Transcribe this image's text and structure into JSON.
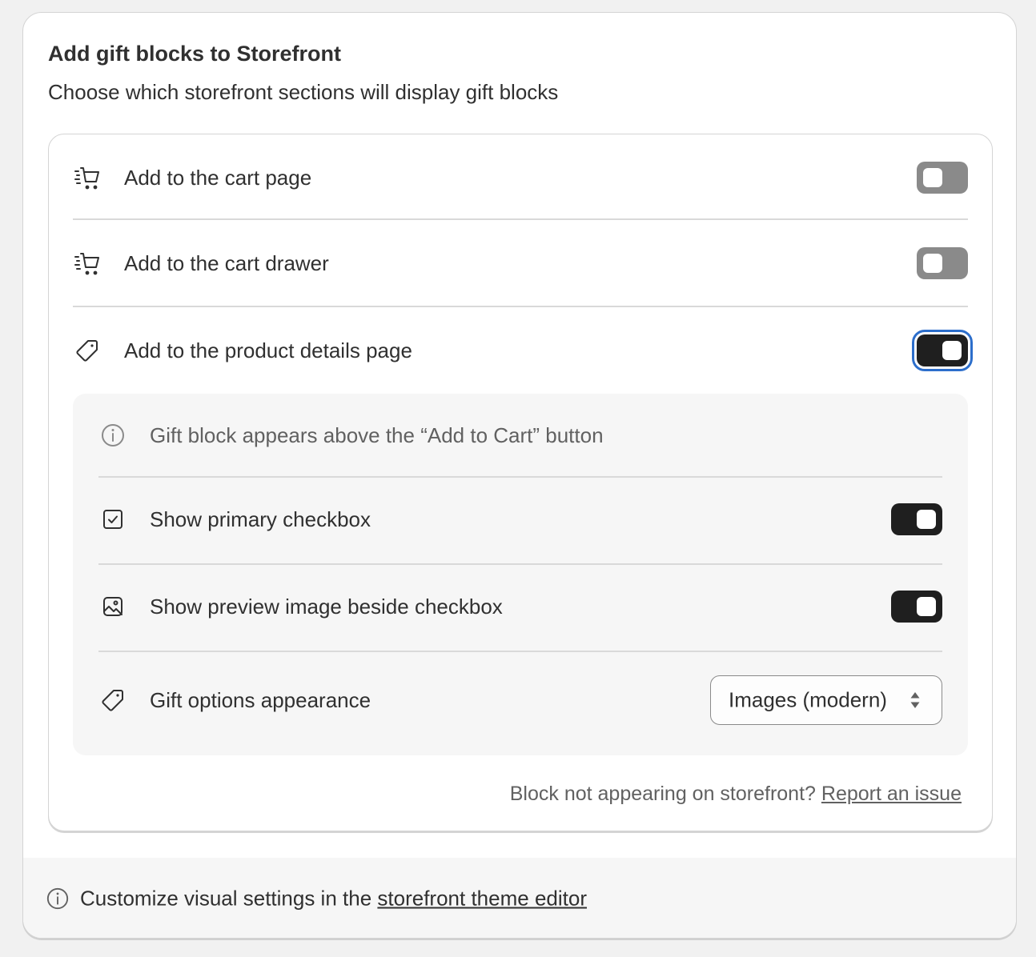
{
  "card": {
    "title": "Add gift blocks to Storefront",
    "subtitle": "Choose which storefront sections will display gift blocks"
  },
  "sections": [
    {
      "label": "Add to the cart page",
      "icon": "cart-fast-icon",
      "enabled": false
    },
    {
      "label": "Add to the cart drawer",
      "icon": "cart-fast-icon",
      "enabled": false
    },
    {
      "label": "Add to the product details page",
      "icon": "tag-icon",
      "enabled": true,
      "focused": true
    }
  ],
  "product_details": {
    "info_text": "Gift block appears above the “Add to Cart” button",
    "info_icon": "info-icon",
    "options": [
      {
        "label": "Show primary checkbox",
        "icon": "checkbox-icon",
        "enabled": true
      },
      {
        "label": "Show preview image beside checkbox",
        "icon": "image-icon",
        "enabled": true
      }
    ],
    "appearance": {
      "label": "Gift options appearance",
      "icon": "tag-icon",
      "selected": "Images (modern)"
    }
  },
  "footnote": {
    "text": "Block not appearing on storefront?",
    "link": "Report an issue"
  },
  "footer": {
    "text": "Customize visual settings in the",
    "link": "storefront theme editor",
    "icon": "info-icon"
  },
  "colors": {
    "toggle_on": "#1f1f1f",
    "toggle_off": "#8a8a8a",
    "focus_ring": "#2c6ecb",
    "panel_background": "#f6f6f6"
  }
}
